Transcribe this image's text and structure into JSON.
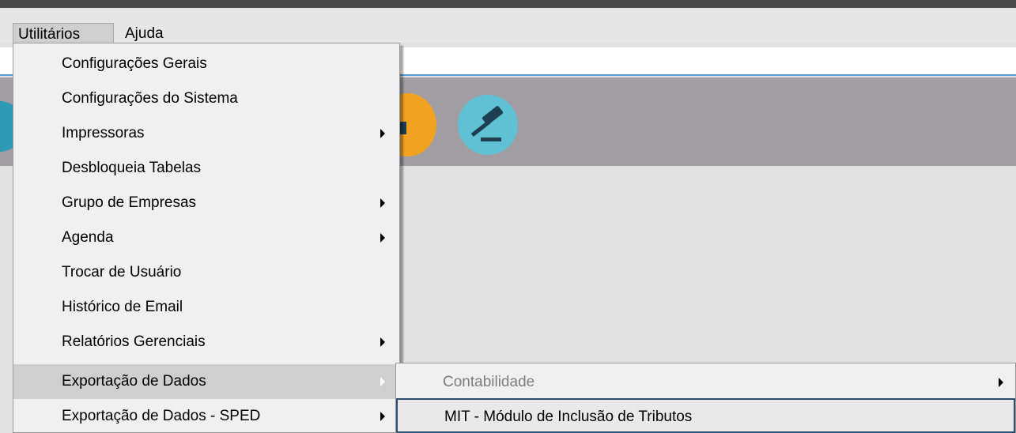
{
  "menubar": {
    "items": [
      {
        "label": "Utilitários"
      },
      {
        "label": "Ajuda"
      }
    ]
  },
  "dropdown": {
    "items": [
      {
        "label": "Configurações Gerais",
        "has_submenu": false
      },
      {
        "label": "Configurações do Sistema",
        "has_submenu": false
      },
      {
        "label": "Impressoras",
        "has_submenu": true
      },
      {
        "label": "Desbloqueia Tabelas",
        "has_submenu": false
      },
      {
        "label": "Grupo de Empresas",
        "has_submenu": true
      },
      {
        "label": "Agenda",
        "has_submenu": true
      },
      {
        "label": "Trocar de Usuário",
        "has_submenu": false
      },
      {
        "label": "Histórico de Email",
        "has_submenu": false
      },
      {
        "label": "Relatórios Gerenciais",
        "has_submenu": true
      },
      {
        "label": "Exportação de Dados",
        "has_submenu": true,
        "highlighted": true
      },
      {
        "label": "Exportação de Dados - SPED",
        "has_submenu": true
      }
    ]
  },
  "submenu": {
    "items": [
      {
        "label": "Contabilidade",
        "has_submenu": true,
        "disabled": true
      },
      {
        "label": "MIT - Módulo de Inclusão de Tributos",
        "has_submenu": false,
        "hovered": true
      }
    ]
  },
  "toolbar_icons": [
    "app-icon-partial",
    "chat-icon",
    "gavel-icon"
  ],
  "colors": {
    "menu_background": "#f0f0f0",
    "highlight": "#cfcfcf",
    "icon_band": "#a09ea3",
    "hover_border": "#2b4f73",
    "accent_line": "#5b9bd5"
  }
}
